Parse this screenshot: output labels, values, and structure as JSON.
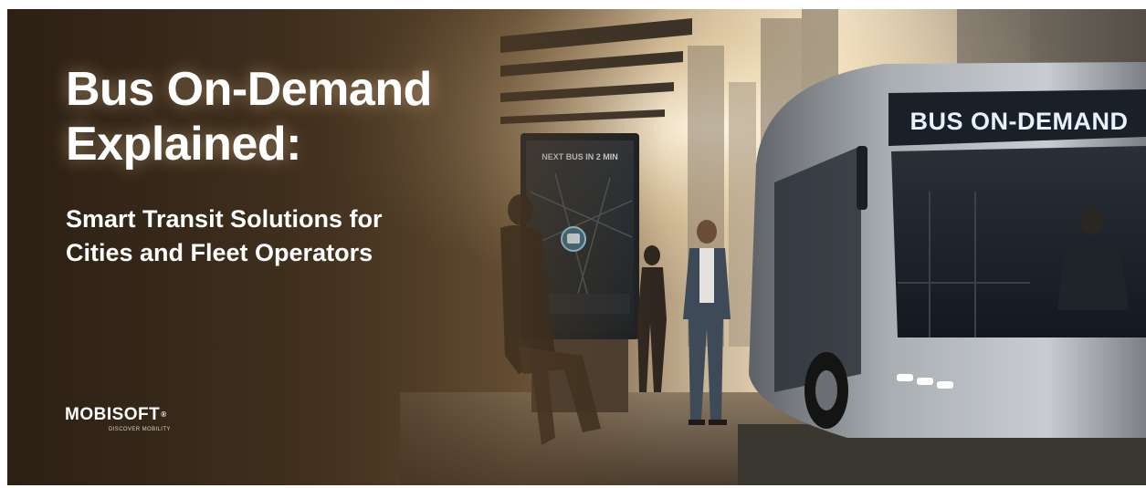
{
  "banner": {
    "title_line1": "Bus On-Demand",
    "title_line2": "Explained:",
    "subtitle_line1": "Smart Transit Solutions for",
    "subtitle_line2": "Cities and Fleet Operators"
  },
  "scene": {
    "bus_sign": "BUS ON-DEMAND",
    "kiosk_header": "NEXT BUS IN 2 MIN"
  },
  "logo": {
    "wordmark": "MOBISOFT",
    "registered": "®",
    "tagline": "DISCOVER MOBILITY"
  },
  "colors": {
    "background_dark": "#2c2014",
    "sky_glow": "#f3e1bd",
    "bus_body": "#9aa0a6",
    "sign_text": "#e8f2ff",
    "title_text": "#ffffff"
  }
}
